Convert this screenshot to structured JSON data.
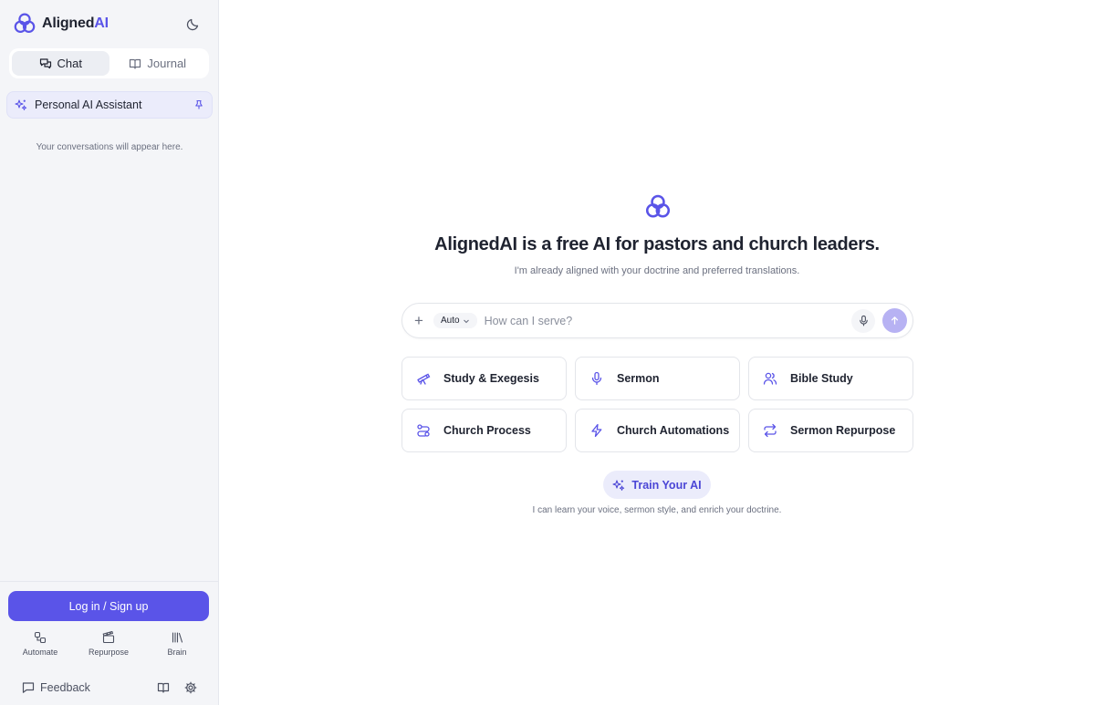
{
  "brand": {
    "name_prefix": "Aligned",
    "name_suffix": "AI"
  },
  "sidebar": {
    "tabs": [
      {
        "label": "Chat",
        "active": true,
        "icon": "chat-bubbles-icon"
      },
      {
        "label": "Journal",
        "active": false,
        "icon": "book-open-icon"
      }
    ],
    "assistant": {
      "label": "Personal AI Assistant",
      "icon": "sparkles-icon",
      "pin_icon": "pin-icon"
    },
    "empty_state": "Your conversations will appear here.",
    "login_label": "Log in / Sign up",
    "quick_nav": [
      {
        "label": "Automate",
        "icon": "shapes-icon"
      },
      {
        "label": "Repurpose",
        "icon": "clapperboard-icon"
      },
      {
        "label": "Brain",
        "icon": "library-icon"
      }
    ],
    "feedback_label": "Feedback"
  },
  "main": {
    "headline": "AlignedAI is a free AI for pastors and church leaders.",
    "subline": "I'm already aligned with your doctrine and preferred translations.",
    "composer": {
      "model": "Auto",
      "placeholder": "How can I serve?"
    },
    "cards": [
      {
        "label": "Study & Exegesis",
        "icon": "telescope-icon"
      },
      {
        "label": "Sermon",
        "icon": "microphone-icon"
      },
      {
        "label": "Bible Study",
        "icon": "users-icon"
      },
      {
        "label": "Church Process",
        "icon": "route-icon"
      },
      {
        "label": "Church Automations",
        "icon": "lightning-icon"
      },
      {
        "label": "Sermon Repurpose",
        "icon": "repeat-icon"
      }
    ],
    "train_button": "Train Your AI",
    "train_caption": "I can learn your voice, sermon style, and enrich your doctrine."
  },
  "colors": {
    "accent": "#5a54e8",
    "accent_soft": "#ebecfb",
    "send_disabled": "#b7b2f3"
  }
}
